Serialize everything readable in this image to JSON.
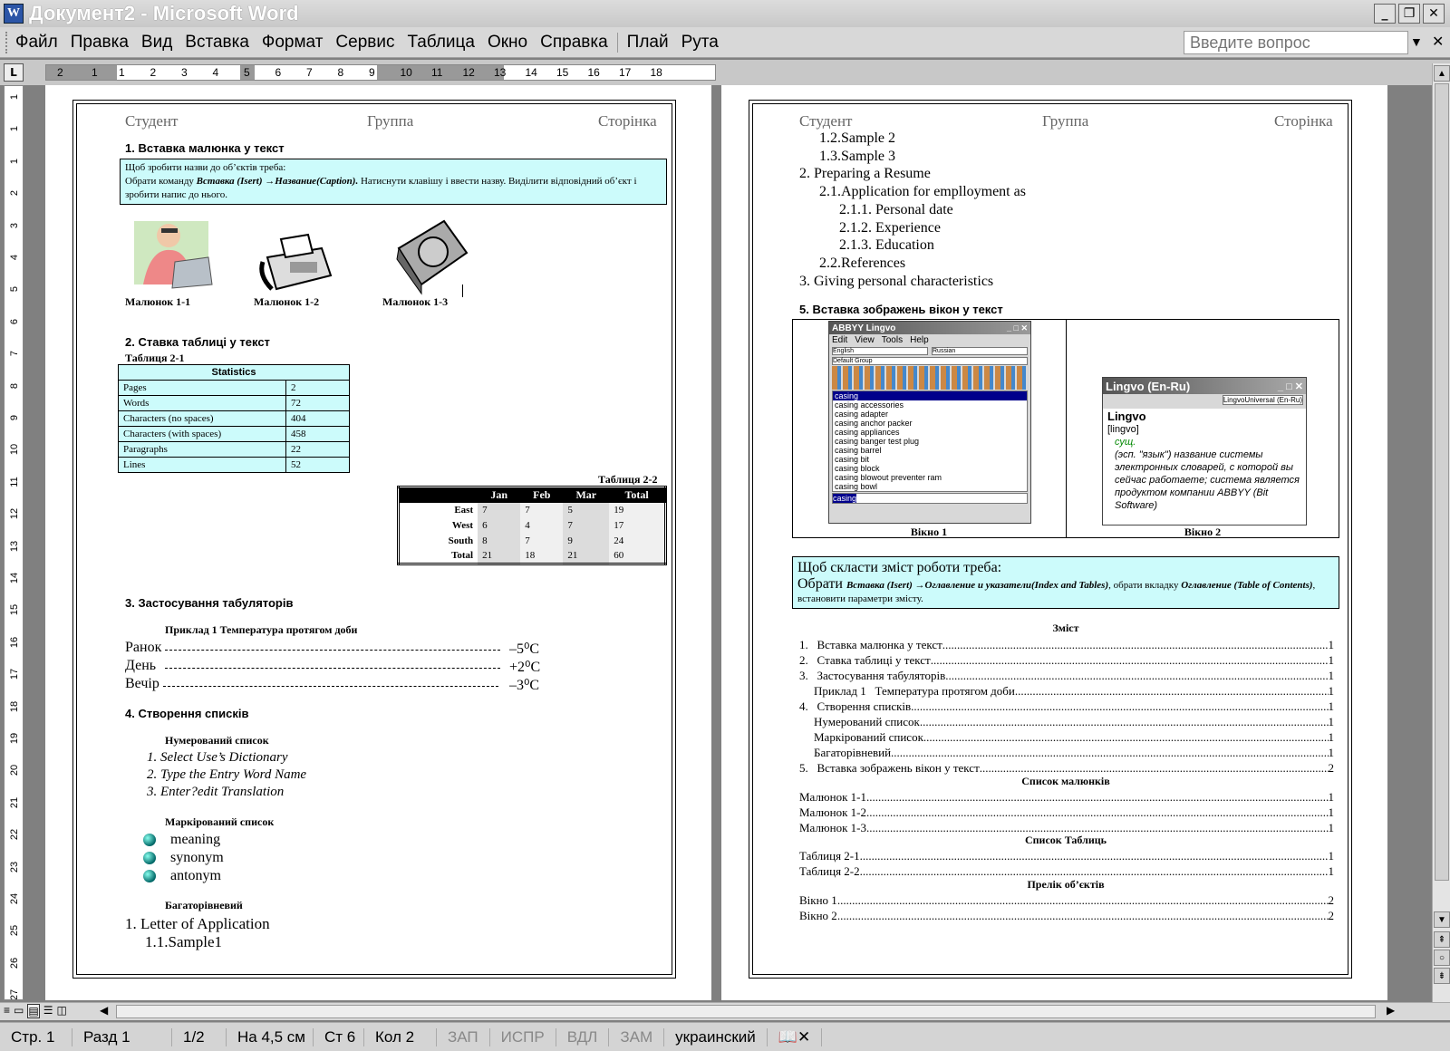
{
  "window": {
    "title": "Документ2 - Microsoft Word",
    "app_icon": "word-app-icon"
  },
  "menu": {
    "items": [
      "Файл",
      "Правка",
      "Вид",
      "Вставка",
      "Формат",
      "Сервис",
      "Таблица",
      "Окно",
      "Справка",
      "Плай",
      "Рута"
    ],
    "ask_placeholder": "Введите вопрос"
  },
  "ruler": {
    "h_numbers": [
      "2",
      "1",
      "1",
      "2",
      "3",
      "4",
      "5",
      "6",
      "7",
      "8",
      "9",
      "10",
      "11",
      "12",
      "13",
      "14",
      "15",
      "16",
      "17",
      "18"
    ],
    "v_numbers": [
      "1",
      "1",
      "1",
      "2",
      "3",
      "4",
      "5",
      "6",
      "7",
      "8",
      "9",
      "10",
      "11",
      "12",
      "13",
      "14",
      "15",
      "16",
      "17",
      "18",
      "19",
      "20",
      "21",
      "22",
      "23",
      "24",
      "25",
      "26",
      "27"
    ],
    "tab_selector": "L"
  },
  "header": {
    "student": "Студент",
    "group": "Группа",
    "page": "Сторінка"
  },
  "page1": {
    "s1_title": "1.  Вставка малюнка у текст",
    "note_line1": "Щоб зробити назви до об’єктів треба:",
    "note_line2_a": "Обрати команду ",
    "note_line2_b": "Вставка (Isert) →Название(Caption).",
    "note_line2_c": " Натиснути клавішу і ввести назву. Виділити відповідний об’єкт і зробити напис до нього.",
    "captions": [
      "Малюнок 1-1",
      "Малюнок 1-2",
      "Малюнок 1-3"
    ],
    "s2_title": "2.  Ставка таблиці у текст",
    "table1_caption": "Таблиця 2-1",
    "stats_header": "Statistics",
    "stats_rows": [
      [
        "Pages",
        "2"
      ],
      [
        "Words",
        "72"
      ],
      [
        "Characters (no spaces)",
        "404"
      ],
      [
        "Characters (with spaces)",
        "458"
      ],
      [
        "Paragraphs",
        "22"
      ],
      [
        "Lines",
        "52"
      ]
    ],
    "table2_caption": "Таблиця 2-2",
    "t22_headers": [
      "",
      "Jan",
      "Feb",
      "Mar",
      "Total"
    ],
    "t22_rows": [
      [
        "East",
        "7",
        "7",
        "5",
        "19"
      ],
      [
        "West",
        "6",
        "4",
        "7",
        "17"
      ],
      [
        "South",
        "8",
        "7",
        "9",
        "24"
      ],
      [
        "Total",
        "21",
        "18",
        "21",
        "60"
      ]
    ],
    "s3_title": "3.  Застосування табуляторів",
    "example_title": "Приклад 1   Температура протягом доби",
    "temps": [
      {
        "label": "Ранок",
        "value": "–5⁰С"
      },
      {
        "label": "День",
        "value": "+2⁰С"
      },
      {
        "label": "Вечір",
        "value": "–3⁰С"
      }
    ],
    "s4_title": "4.  Створення списків",
    "numbered_title": "Нумерований список",
    "numbered": [
      "1.  Select Use’s Dictionary",
      "2.  Type the Entry Word Name",
      "3.  Enter?edit Translation"
    ],
    "bulleted_title": "Маркірований список",
    "bulleted": [
      "meaning",
      "synonym",
      "antonym"
    ],
    "multi_title": "Багаторівневий",
    "multi_a": "1.  Letter of Application",
    "multi_b": "1.1.Sample1"
  },
  "page2": {
    "list": [
      {
        "t": "1.2.Sample 2",
        "l": 1
      },
      {
        "t": "1.3.Sample 3",
        "l": 1
      },
      {
        "t": "2.  Preparing a Resume",
        "l": 0
      },
      {
        "t": "2.1.Application for emplloyment as",
        "l": 1
      },
      {
        "t": "2.1.1. Personal date",
        "l": 2
      },
      {
        "t": "2.1.2. Experience",
        "l": 2
      },
      {
        "t": "2.1.3. Education",
        "l": 2
      },
      {
        "t": "2.2.References",
        "l": 1
      },
      {
        "t": "3.  Giving personal characteristics",
        "l": 0
      }
    ],
    "s5_title": "5.  Вставка зображень вікон у текст",
    "win1": {
      "title": "ABBYY Lingvo",
      "menu": [
        "Edit",
        "View",
        "Tools",
        "Help"
      ],
      "lang1": "English",
      "lang2": "Russian",
      "group": "Default Group",
      "entries": [
        "casing",
        "casing accessories",
        "casing adapter",
        "casing anchor packer",
        "casing appliances",
        "casing banger test plug",
        "casing barrel",
        "casing bit",
        "casing block",
        "casing blowout preventer ram",
        "casing bowl"
      ],
      "input": "casing",
      "caption": "Вікно 1"
    },
    "win2": {
      "title": "Lingvo (En-Ru)",
      "dict": "LingvoUniversal (En-Ru)",
      "word": "Lingvo",
      "transcription": "[lingvo]",
      "pos": "сущ.",
      "text": "(эсп. \"язык\") название системы электронных словарей, с которой вы сейчас работаете; система является продуктом компании ABBYY (Bit Software)",
      "caption": "Вікно 2"
    },
    "box_l1": "Щоб скласти зміст роботи треба:",
    "box_a": "Обрати ",
    "box_b": "Вставка (Isert) →Оглавление и указатели(Index and Tables)",
    "box_c": ", обрати вкладку ",
    "box_d": "Оглавление",
    "box_e": " (Table of Contents)",
    "box_f": ", встановити параметри змісту.",
    "toc_title": "Зміст",
    "toc": [
      {
        "t": "1.   Вставка малюнка у текст",
        "p": "1",
        "i": 0
      },
      {
        "t": "2.   Ставка таблиці у текст",
        "p": "1",
        "i": 0
      },
      {
        "t": "3.   Застосування табуляторів",
        "p": "1",
        "i": 0
      },
      {
        "t": "Приклад 1   Температура протягом доби",
        "p": "1",
        "i": 1
      },
      {
        "t": "4.   Створення списків",
        "p": "1",
        "i": 0
      },
      {
        "t": "Нумерований список",
        "p": "1",
        "i": 1
      },
      {
        "t": "Маркірований список",
        "p": "1",
        "i": 1
      },
      {
        "t": "Багаторівневий",
        "p": "1",
        "i": 1
      },
      {
        "t": "5.   Вставка зображень вікон у текст",
        "p": "2",
        "i": 0
      }
    ],
    "fig_title": "Список малюнків",
    "figs": [
      {
        "t": "Малюнок 1-1",
        "p": "1"
      },
      {
        "t": "Малюнок 1-2",
        "p": "1"
      },
      {
        "t": "Малюнок 1-3",
        "p": "1"
      }
    ],
    "tab_title": "Список Таблиць",
    "tabs": [
      {
        "t": "Таблиця 2-1",
        "p": "1"
      },
      {
        "t": "Таблиця 2-2",
        "p": "1"
      }
    ],
    "obj_title": "Прелік об’єктів",
    "objs": [
      {
        "t": "Вікно 1",
        "p": "2"
      },
      {
        "t": "Вікно 2",
        "p": "2"
      }
    ]
  },
  "status": {
    "page": "Стр. 1",
    "section": "Разд 1",
    "pages": "1/2",
    "at": "На 4,5 см",
    "line": "Ст 6",
    "col": "Кол 2",
    "rec": "ЗАП",
    "trk": "ИСПР",
    "ext": "ВДЛ",
    "ovr": "ЗАМ",
    "lang": "украинский"
  },
  "colors": {
    "note_bg": "#ccfbfb",
    "title_text": "#ffffff",
    "page_bg": "#ffffff",
    "workspace": "#808080"
  }
}
